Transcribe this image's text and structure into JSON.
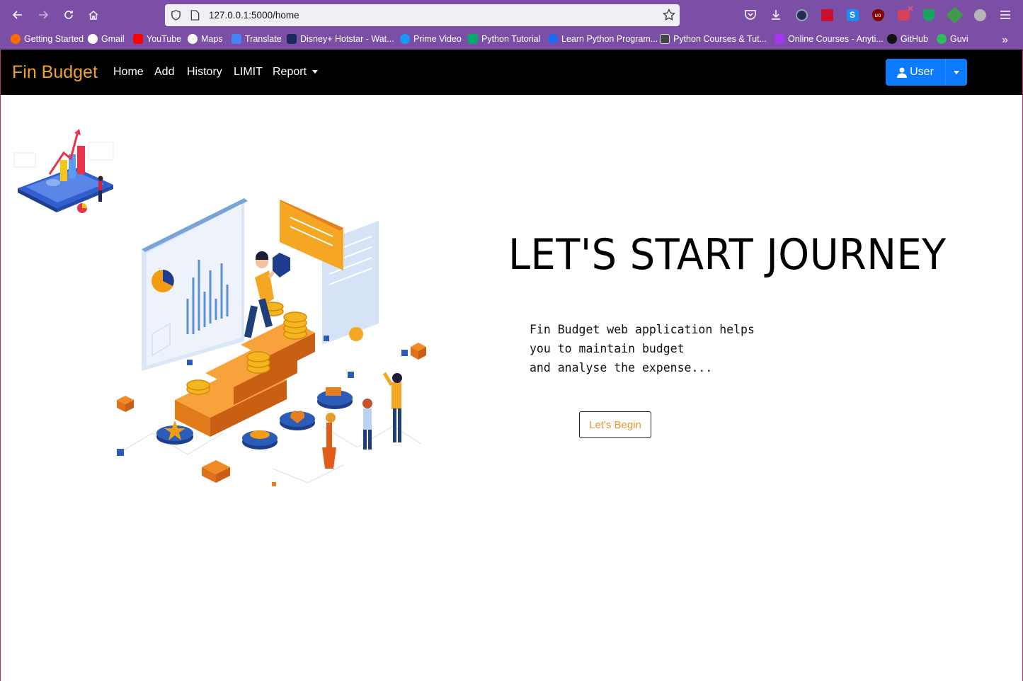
{
  "browser": {
    "url": "127.0.0.1:5000/home",
    "bookmarks": [
      {
        "label": "Getting Started",
        "color": "#ff6a00"
      },
      {
        "label": "Gmail",
        "color": "#ea4335"
      },
      {
        "label": "YouTube",
        "color": "#ff0000"
      },
      {
        "label": "Maps",
        "color": "#ffffff"
      },
      {
        "label": "Translate",
        "color": "#4285f4"
      },
      {
        "label": "Disney+ Hotstar - Wat...",
        "color": "#1b2a5c"
      },
      {
        "label": "Prime Video",
        "color": "#1a98ff"
      },
      {
        "label": "Python Tutorial",
        "color": "#04aa6d"
      },
      {
        "label": "Learn Python Program...",
        "color": "#1e6bf0"
      },
      {
        "label": "Python Courses & Tut...",
        "color": "#333333"
      },
      {
        "label": "Online Courses - Anyti...",
        "color": "#a435f0"
      },
      {
        "label": "GitHub",
        "color": "#111111"
      },
      {
        "label": "Guvi",
        "color": "#2ebd59"
      }
    ]
  },
  "navbar": {
    "brand": "Fin Budget",
    "links": [
      "Home",
      "Add",
      "History",
      "LIMIT",
      "Report"
    ],
    "user_label": "User"
  },
  "hero": {
    "title": "LET'S START JOURNEY",
    "desc_lines": [
      "Fin Budget web application helps",
      "you to maintain budget",
      "and analyse the expense..."
    ],
    "cta_label": "Let's Begin"
  },
  "colors": {
    "accent_orange": "#f0a22c",
    "user_button": "#0d7bff",
    "chrome_purple": "#7b4fa6"
  }
}
